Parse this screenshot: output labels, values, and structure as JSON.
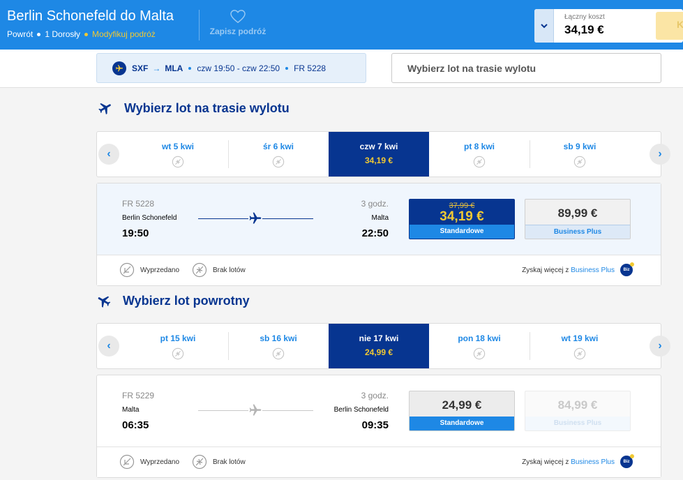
{
  "header": {
    "route_title": "Berlin Schonefeld do Malta",
    "trip_type": "Powrót",
    "passengers": "1 Dorosły",
    "modify_link": "Modyfikuj podróż",
    "save_trip": "Zapisz podróż",
    "total_label": "Łączny koszt",
    "total_value": "34,19 €",
    "continue_label": "K"
  },
  "selected_leg": {
    "from": "SXF",
    "to": "MLA",
    "times": "czw 19:50 - czw 22:50",
    "flight_no": "FR 5228",
    "return_placeholder": "Wybierz lot na trasie wylotu"
  },
  "outbound": {
    "heading": "Wybierz lot na trasie wylotu",
    "days": [
      {
        "label": "wt 5 kwi",
        "price": ""
      },
      {
        "label": "śr 6 kwi",
        "price": ""
      },
      {
        "label": "czw 7 kwi",
        "price": "34,19 €"
      },
      {
        "label": "pt 8 kwi",
        "price": ""
      },
      {
        "label": "sb 9 kwi",
        "price": ""
      }
    ],
    "flight": {
      "number": "FR 5228",
      "duration": "3 godz.",
      "from_city": "Berlin Schonefeld",
      "to_city": "Malta",
      "dep_time": "19:50",
      "arr_time": "22:50",
      "std_old_price": "37,99 €",
      "std_price": "34,19 €",
      "std_label": "Standardowe",
      "biz_price": "89,99 €",
      "biz_label": "Business Plus"
    }
  },
  "inbound": {
    "heading": "Wybierz lot powrotny",
    "days": [
      {
        "label": "pt 15 kwi",
        "price": ""
      },
      {
        "label": "sb 16 kwi",
        "price": ""
      },
      {
        "label": "nie 17 kwi",
        "price": "24,99 €"
      },
      {
        "label": "pon 18 kwi",
        "price": ""
      },
      {
        "label": "wt 19 kwi",
        "price": ""
      }
    ],
    "flight": {
      "number": "FR 5229",
      "duration": "3 godz.",
      "from_city": "Malta",
      "to_city": "Berlin Schonefeld",
      "dep_time": "06:35",
      "arr_time": "09:35",
      "std_price": "24,99 €",
      "std_label": "Standardowe",
      "biz_price": "84,99 €",
      "biz_label": "Business Plus"
    }
  },
  "legend": {
    "sold_out": "Wyprzedano",
    "no_flights": "Brak lotów",
    "biz_prefix": "Zyskaj więcej z",
    "biz_link": "Business Plus",
    "biz_badge": "Biz"
  },
  "colors": {
    "brand_blue": "#1e88e5",
    "navy": "#073590",
    "accent_yellow": "#f1c933"
  }
}
